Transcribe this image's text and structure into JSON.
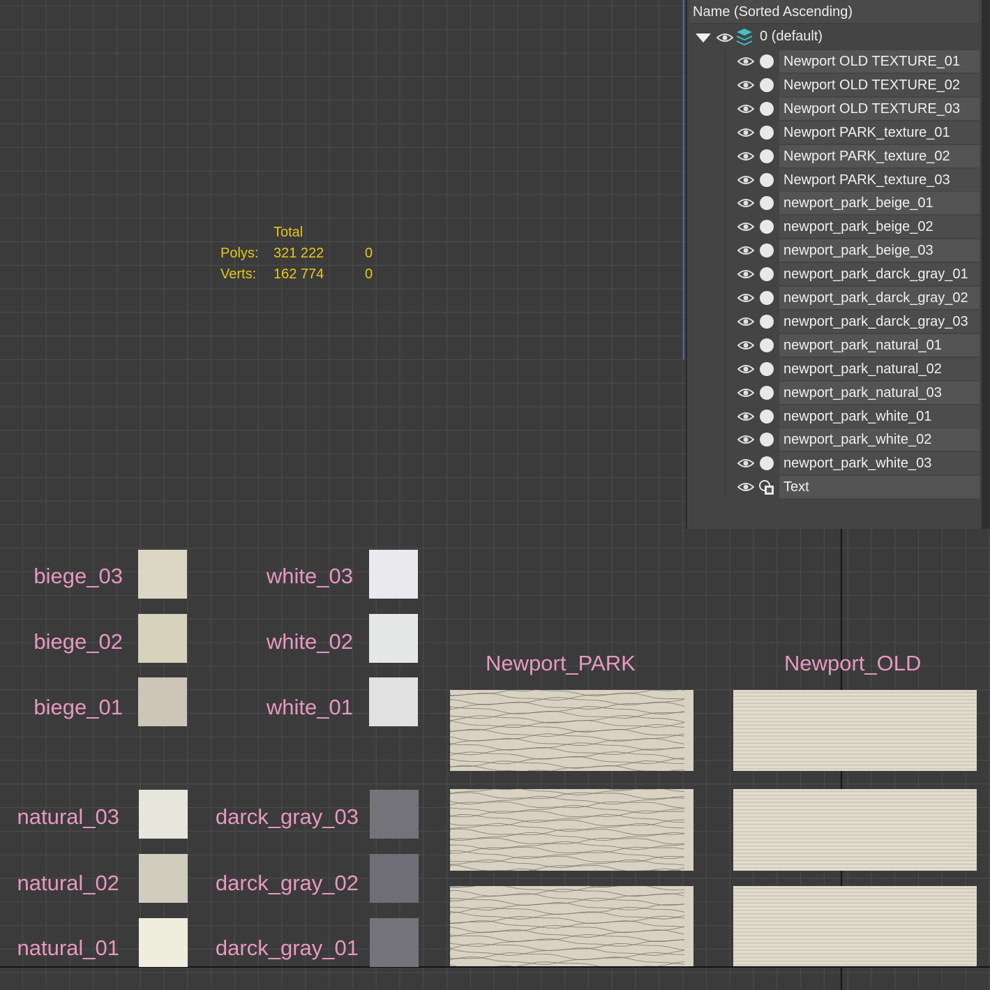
{
  "stats": {
    "header": "Total",
    "polys_label": "Polys:",
    "polys_value": "321 222",
    "polys_selected": "0",
    "verts_label": "Verts:",
    "verts_value": "162 774",
    "verts_selected": "0"
  },
  "explorer": {
    "column_header": "Name (Sorted Ascending)",
    "default_layer": "0 (default)",
    "layers": [
      {
        "name": "Newport OLD  TEXTURE_01",
        "icon": "circle-dot-icon"
      },
      {
        "name": "Newport OLD  TEXTURE_02",
        "icon": "circle-dot-icon"
      },
      {
        "name": "Newport OLD  TEXTURE_03",
        "icon": "circle-dot-icon"
      },
      {
        "name": "Newport PARK_texture_01",
        "icon": "circle-dot-icon"
      },
      {
        "name": "Newport PARK_texture_02",
        "icon": "circle-dot-icon"
      },
      {
        "name": "Newport PARK_texture_03",
        "icon": "circle-dot-icon"
      },
      {
        "name": "newport_park_beige_01",
        "icon": "circle-dot-icon"
      },
      {
        "name": "newport_park_beige_02",
        "icon": "circle-dot-icon"
      },
      {
        "name": "newport_park_beige_03",
        "icon": "circle-dot-icon"
      },
      {
        "name": "newport_park_darck_gray_01",
        "icon": "circle-dot-icon"
      },
      {
        "name": "newport_park_darck_gray_02",
        "icon": "circle-dot-icon"
      },
      {
        "name": "newport_park_darck_gray_03",
        "icon": "circle-dot-icon"
      },
      {
        "name": "newport_park_natural_01",
        "icon": "circle-dot-icon"
      },
      {
        "name": "newport_park_natural_02",
        "icon": "circle-dot-icon"
      },
      {
        "name": "newport_park_natural_03",
        "icon": "circle-dot-icon"
      },
      {
        "name": "newport_park_white_01",
        "icon": "circle-dot-icon"
      },
      {
        "name": "newport_park_white_02",
        "icon": "circle-dot-icon"
      },
      {
        "name": "newport_park_white_03",
        "icon": "circle-dot-icon"
      },
      {
        "name": "Text",
        "icon": "shape-text-icon"
      }
    ]
  },
  "swatches": {
    "biege_03": {
      "label": "biege_03",
      "color": "#dcd7c4"
    },
    "biege_02": {
      "label": "biege_02",
      "color": "#d6d2bc"
    },
    "biege_01": {
      "label": "biege_01",
      "color": "#cdc6b8"
    },
    "white_03": {
      "label": "white_03",
      "color": "#e9e9ee"
    },
    "white_02": {
      "label": "white_02",
      "color": "#e6e7e7"
    },
    "white_01": {
      "label": "white_01",
      "color": "#e2e1e2"
    },
    "natural_03": {
      "label": "natural_03",
      "color": "#e7e6dd"
    },
    "natural_02": {
      "label": "natural_02",
      "color": "#d0cdbf"
    },
    "natural_01": {
      "label": "natural_01",
      "color": "#eeedde"
    },
    "darck_gray_03": {
      "label": "darck_gray_03",
      "color": "#75737a"
    },
    "darck_gray_02": {
      "label": "darck_gray_02",
      "color": "#6f6d75"
    },
    "darck_gray_01": {
      "label": "darck_gray_01",
      "color": "#74727a"
    }
  },
  "panels": {
    "park_title": "Newport_PARK",
    "old_title": "Newport_OLD",
    "park_color": "#d9d2c2",
    "old_color": "#e1dccd"
  },
  "colors": {
    "label_pink": "#e898c0",
    "stats_yellow": "#e6c81e",
    "viewport_bg": "#3b3b3b"
  }
}
